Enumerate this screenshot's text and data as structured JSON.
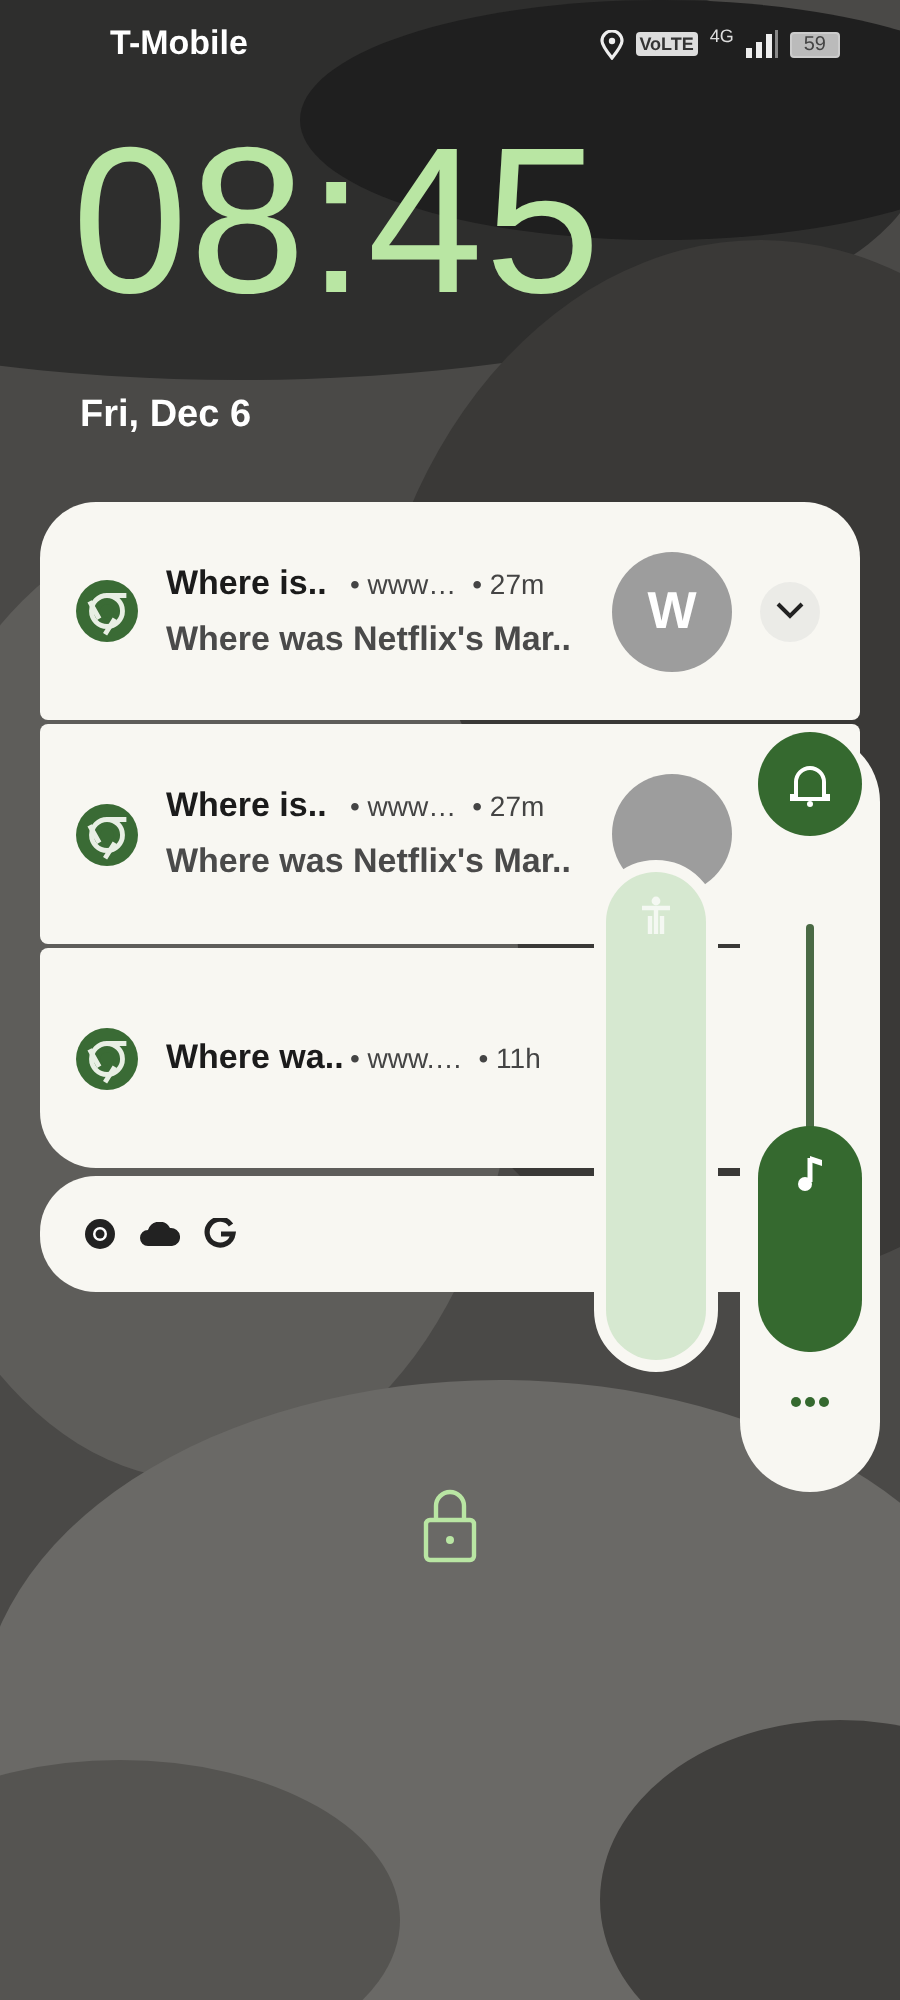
{
  "status_bar": {
    "carrier": "T-Mobile",
    "volte": "VoLTE",
    "network": "4G",
    "battery": "59"
  },
  "clock": {
    "time": "08:45",
    "date": "Fri, Dec 6"
  },
  "notifications": [
    {
      "title": "Where is..",
      "source": "• www…",
      "time": "• 27m",
      "body": "Where was Netflix's Mar..",
      "avatar": "W",
      "expand_button": true
    },
    {
      "title": "Where is..",
      "source": "• www…",
      "time": "• 27m",
      "body": "Where was Netflix's Mar..",
      "has_avatar": true,
      "expand_button": false
    },
    {
      "title": "Where wa..",
      "source": "• www.…",
      "time": "• 11h",
      "expand_button": false
    }
  ],
  "footer_icons": [
    {
      "kind": "chrome"
    },
    {
      "kind": "cloud"
    },
    {
      "kind": "google"
    }
  ],
  "volume_panel": {
    "sliders": [
      {
        "kind": "accessibility",
        "level": 1
      },
      {
        "kind": "media",
        "level": 0.53
      }
    ]
  }
}
